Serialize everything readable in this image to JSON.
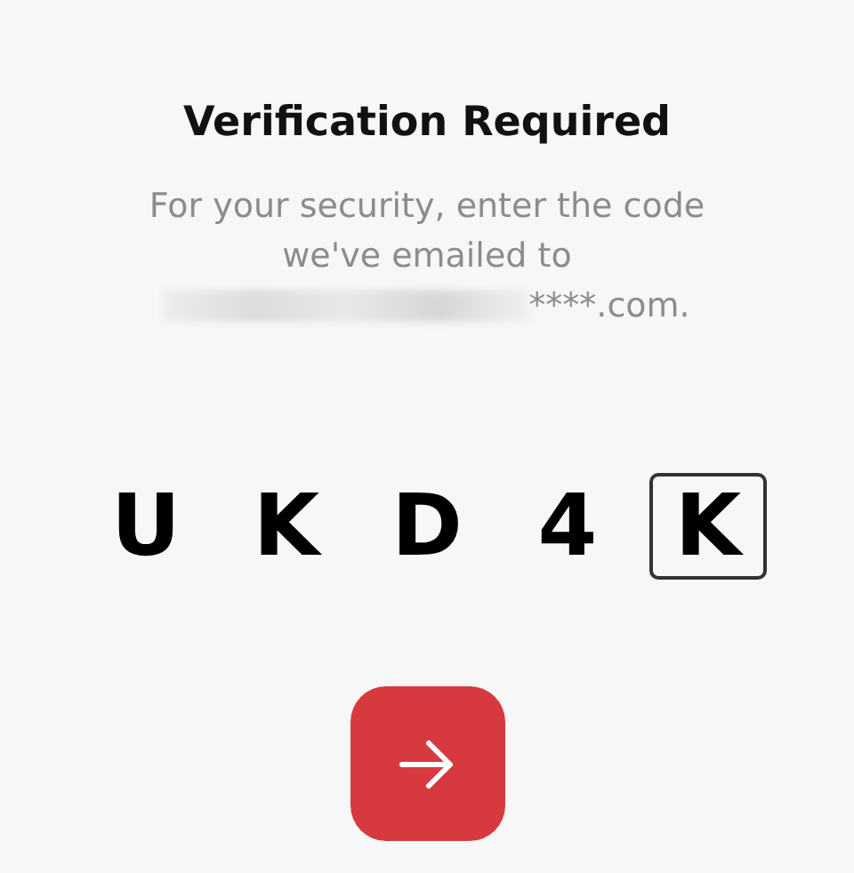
{
  "title": "Verification Required",
  "message": {
    "line_1": "For your security, enter the code",
    "line_2": "we've emailed to",
    "email_visible": "****.com.",
    "email_redacted": true
  },
  "code": [
    {
      "char": "U",
      "selected": false
    },
    {
      "char": "K",
      "selected": false
    },
    {
      "char": "D",
      "selected": false
    },
    {
      "char": "4",
      "selected": false
    },
    {
      "char": "K",
      "selected": true
    }
  ],
  "submit": {
    "kind": "arrow"
  }
}
